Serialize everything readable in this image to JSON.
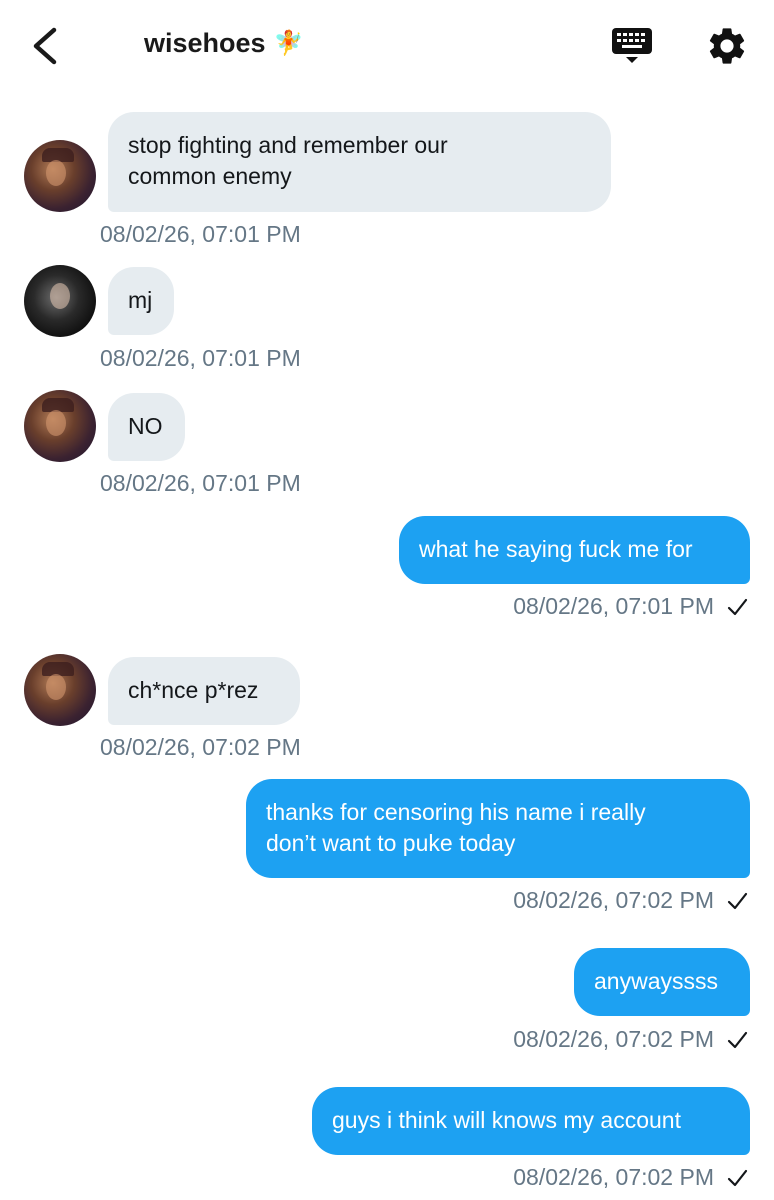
{
  "header": {
    "title": "wisehoes",
    "title_emoji": "🧚",
    "back_icon": "chevron-left-icon",
    "keyboard_icon": "keyboard-icon",
    "settings_icon": "gear-icon"
  },
  "messages": [
    {
      "direction": "in",
      "avatar": "avatar-1",
      "text_line1": "stop fighting and remember our",
      "text_line2": "common enemy",
      "timestamp": "08/02/26, 07:01 PM"
    },
    {
      "direction": "in",
      "avatar": "avatar-2",
      "text": "mj",
      "timestamp": "08/02/26, 07:01 PM"
    },
    {
      "direction": "in",
      "avatar": "avatar-1",
      "text": "NO",
      "timestamp": "08/02/26, 07:01 PM"
    },
    {
      "direction": "out",
      "text": "what he saying fuck me for",
      "timestamp": "08/02/26, 07:01 PM"
    },
    {
      "direction": "in",
      "avatar": "avatar-1",
      "text": "ch*nce p*rez",
      "timestamp": "08/02/26, 07:02 PM"
    },
    {
      "direction": "out",
      "text_line1": "thanks for censoring his name i really",
      "text_line2": "don’t want to puke today",
      "timestamp": "08/02/26, 07:02 PM"
    },
    {
      "direction": "out",
      "text": "anywayssss",
      "timestamp": "08/02/26, 07:02 PM"
    },
    {
      "direction": "out",
      "text": "guys i think will knows my account",
      "timestamp": "08/02/26, 07:02 PM"
    }
  ],
  "colors": {
    "outgoing_bubble": "#1da1f2",
    "incoming_bubble": "#e6ecf0",
    "timestamp": "#657786"
  }
}
